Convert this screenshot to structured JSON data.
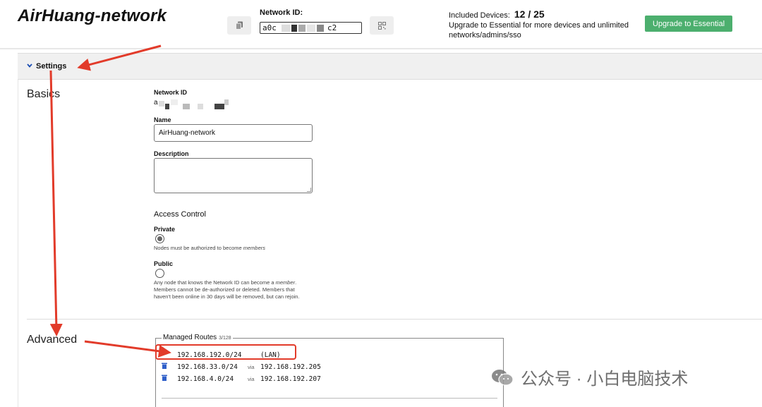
{
  "header": {
    "network_name": "AirHuang-network",
    "network_id_label": "Network ID:",
    "network_id_visible_start": "a0c",
    "network_id_visible_end": "c2",
    "included_devices_label": "Included Devices:",
    "included_devices_count": "12 / 25",
    "upgrade_text": "Upgrade to Essential for more devices and unlimited networks/admins/sso",
    "upgrade_button": "Upgrade to Essential",
    "copy_icon": "copy-icon",
    "qr_icon": "qr-code-icon"
  },
  "settings": {
    "toggle_label": "Settings",
    "basics": {
      "heading": "Basics",
      "network_id_label": "Network ID",
      "network_id_value_start": "a",
      "name_label": "Name",
      "name_value": "AirHuang-network",
      "description_label": "Description",
      "description_value": "",
      "access_control_title": "Access Control",
      "private_label": "Private",
      "private_help_prefix": "Nodes must be authorized to become ",
      "private_help_em": "members",
      "private_selected": true,
      "public_label": "Public",
      "public_help_line1_prefix": "Any node that knows the Network ID can become a ",
      "public_help_line1_em": "member",
      "public_help_line1_suffix": ".",
      "public_help_line2": "Members cannot be de-authorized or deleted. Members that",
      "public_help_line3": "haven't been online in 30 days will be removed, but can rejoin.",
      "public_selected": false
    },
    "advanced": {
      "heading": "Advanced",
      "managed_routes_title": "Managed Routes",
      "managed_routes_count": "3/128",
      "routes": [
        {
          "target": "192.168.192.0/24",
          "via": "",
          "gateway": "",
          "tag": "(LAN)"
        },
        {
          "target": "192.168.33.0/24",
          "via": "via",
          "gateway": "192.168.192.205",
          "tag": ""
        },
        {
          "target": "192.168.4.0/24",
          "via": "via",
          "gateway": "192.168.192.207",
          "tag": ""
        }
      ]
    }
  },
  "watermark": {
    "text": "公众号 · 小白电脑技术"
  },
  "colors": {
    "upgrade_button": "#4caf6e",
    "annotation_red": "#e23b2a",
    "chevron_blue": "#1a4db3",
    "trash_blue": "#2f5fc9"
  }
}
